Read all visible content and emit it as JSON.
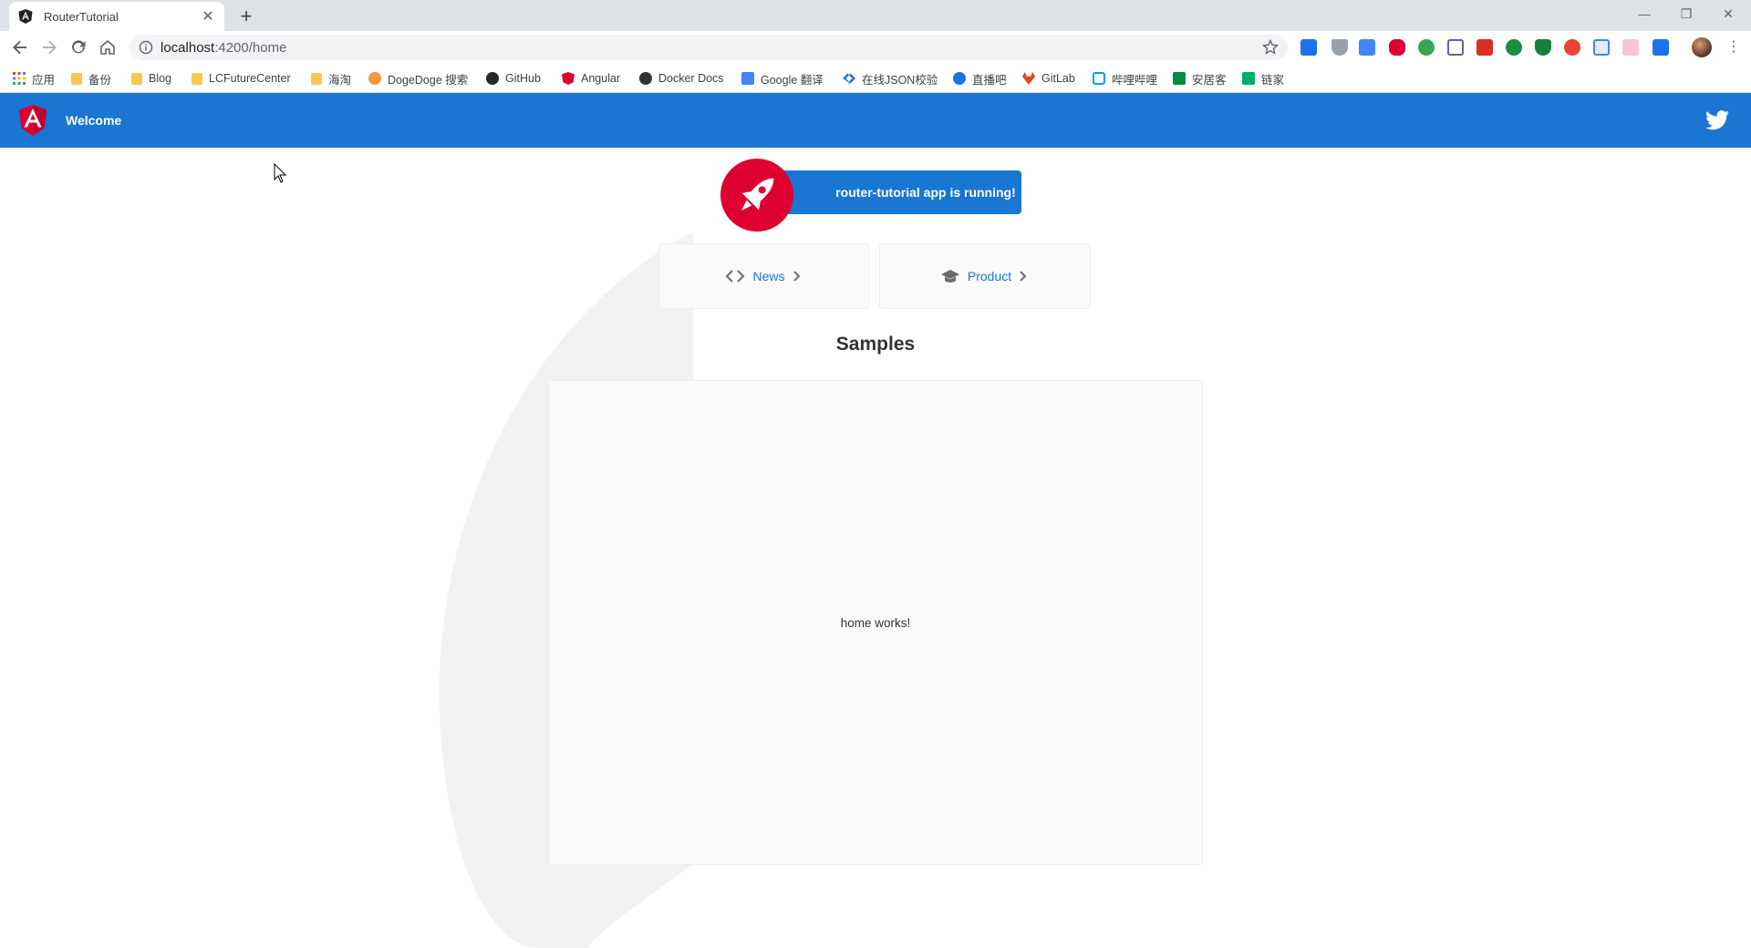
{
  "browser": {
    "tab_title": "RouterTutorial",
    "tab_close": "✕",
    "new_tab": "+",
    "url_host": "localhost",
    "url_path": ":4200/home",
    "window_controls": {
      "minimize": "—",
      "restore": "❐",
      "close": "✕"
    }
  },
  "bookmarks": [
    {
      "label": "应用",
      "icon": "apps-grid-icon"
    },
    {
      "label": "备份",
      "icon": "folder-icon"
    },
    {
      "label": "Blog",
      "icon": "folder-icon"
    },
    {
      "label": "LCFutureCenter",
      "icon": "folder-icon"
    },
    {
      "label": "海淘",
      "icon": "folder-icon"
    },
    {
      "label": "DogeDoge 搜索",
      "icon": "dogedoge-icon"
    },
    {
      "label": "GitHub",
      "icon": "github-icon"
    },
    {
      "label": "Angular",
      "icon": "angular-icon"
    },
    {
      "label": "Docker Docs",
      "icon": "docker-icon"
    },
    {
      "label": "Google 翻译",
      "icon": "google-translate-icon"
    },
    {
      "label": "在线JSON校验",
      "icon": "json-icon"
    },
    {
      "label": "直播吧",
      "icon": "zhibo8-icon"
    },
    {
      "label": "GitLab",
      "icon": "gitlab-icon"
    },
    {
      "label": "哔哩哔哩",
      "icon": "bilibili-icon"
    },
    {
      "label": "安居客",
      "icon": "anjuke-icon"
    },
    {
      "label": "链家",
      "icon": "lianjia-icon"
    }
  ],
  "app": {
    "toolbar_title": "Welcome",
    "running_text": "router-tutorial app is running!",
    "nav": [
      {
        "label": "News",
        "icon": "code-brackets-icon"
      },
      {
        "label": "Product",
        "icon": "graduation-cap-icon"
      }
    ],
    "samples_title": "Samples",
    "outlet_text": "home works!"
  },
  "colors": {
    "primary": "#1976d2",
    "rocket_red": "#dd0031",
    "chrome_frame": "#dee1e6"
  }
}
